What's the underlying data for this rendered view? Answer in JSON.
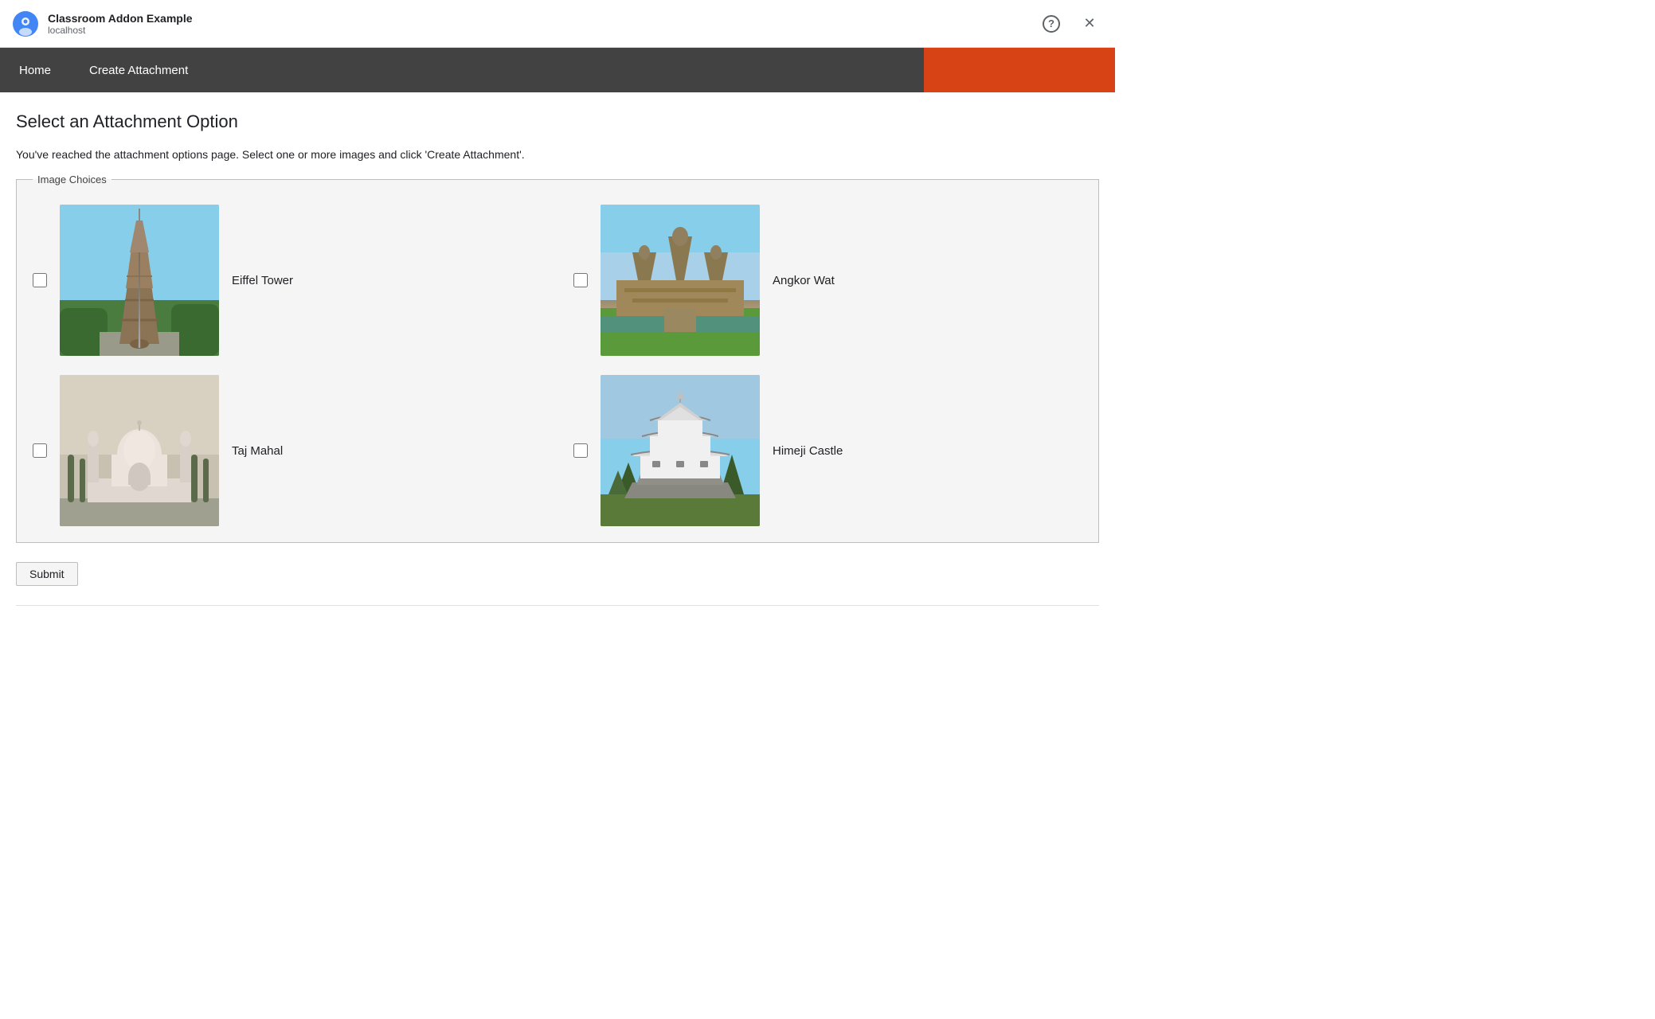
{
  "titleBar": {
    "appTitle": "Classroom Addon Example",
    "appUrl": "localhost",
    "helpIcon": "?",
    "closeIcon": "✕"
  },
  "navBar": {
    "items": [
      {
        "id": "home",
        "label": "Home"
      },
      {
        "id": "create-attachment",
        "label": "Create Attachment"
      }
    ]
  },
  "mainContent": {
    "pageTitle": "Select an Attachment Option",
    "pageDescription": "You've reached the attachment options page. Select one or more images and click 'Create Attachment'.",
    "imageChoicesLabel": "Image Choices",
    "images": [
      {
        "id": "eiffel-tower",
        "label": "Eiffel Tower",
        "checked": false
      },
      {
        "id": "angkor-wat",
        "label": "Angkor Wat",
        "checked": false
      },
      {
        "id": "taj-mahal",
        "label": "Taj Mahal",
        "checked": false
      },
      {
        "id": "himeji-castle",
        "label": "Himeji Castle",
        "checked": false
      }
    ],
    "submitLabel": "Submit"
  }
}
